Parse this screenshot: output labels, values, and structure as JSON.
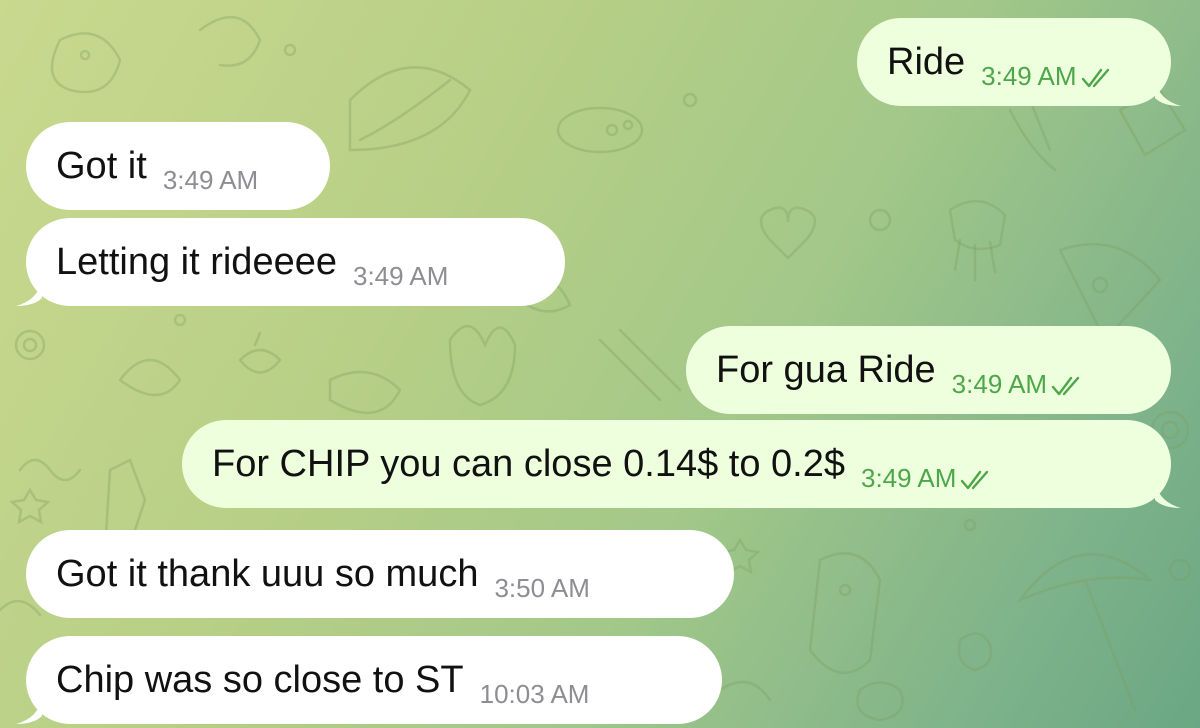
{
  "messages": [
    {
      "id": "m1",
      "direction": "out",
      "text": "Ride",
      "time": "3:49 AM",
      "read": true
    },
    {
      "id": "m2",
      "direction": "in",
      "text": "Got it",
      "time": "3:49 AM"
    },
    {
      "id": "m3",
      "direction": "in",
      "text": "Letting it rideeee",
      "time": "3:49 AM"
    },
    {
      "id": "m4",
      "direction": "out",
      "text": "For gua Ride",
      "time": "3:49 AM",
      "read": true
    },
    {
      "id": "m5",
      "direction": "out",
      "text": "For CHIP you can close 0.14$ to 0.2$",
      "time": "3:49 AM",
      "read": true
    },
    {
      "id": "m6",
      "direction": "in",
      "text": "Got it thank uuu so much",
      "time": "3:50 AM"
    },
    {
      "id": "m7",
      "direction": "in",
      "text": "Chip was so close to ST",
      "time": "10:03 AM"
    }
  ],
  "colors": {
    "incoming_bubble": "#ffffff",
    "outgoing_bubble": "#eeffde",
    "outgoing_meta": "#4ea64a",
    "incoming_meta": "#8d8d93"
  },
  "icons": {
    "read_receipt": "double-check-icon",
    "wallpaper": "doodle-pattern"
  }
}
